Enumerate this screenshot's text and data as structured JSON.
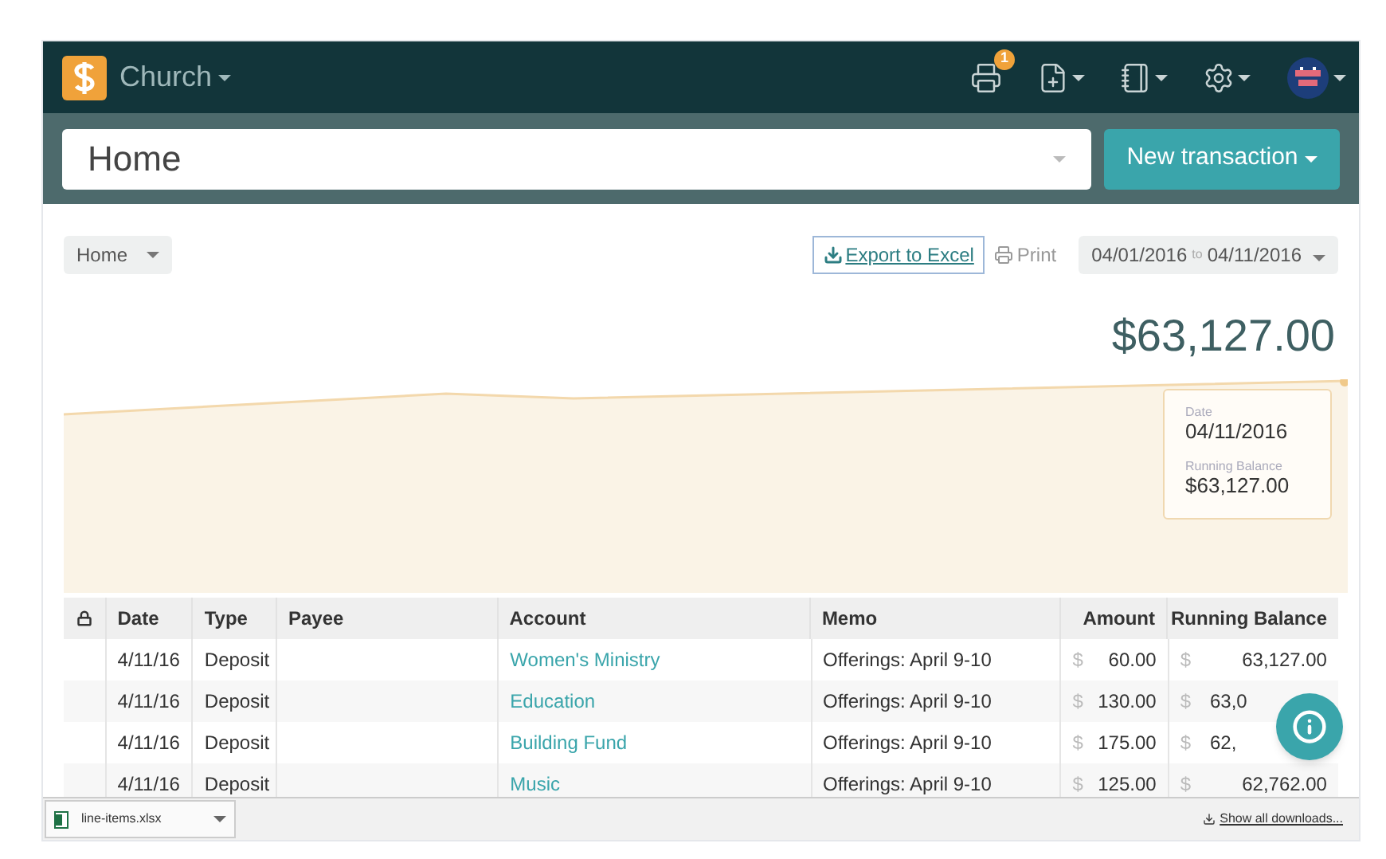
{
  "header": {
    "brand": "Church",
    "notification_count": "1"
  },
  "page_select": {
    "value": "Home"
  },
  "new_transaction": {
    "label": "New transaction"
  },
  "toolbar": {
    "view": "Home",
    "export": "Export to Excel",
    "print": "Print",
    "date_from": "04/01/2016",
    "date_sep": "to",
    "date_to": "04/11/2016"
  },
  "balance": "$63,127.00",
  "tooltip": {
    "date_label": "Date",
    "date": "04/11/2016",
    "balance_label": "Running Balance",
    "balance": "$63,127.00"
  },
  "table": {
    "columns": [
      "Date",
      "Type",
      "Payee",
      "Account",
      "Memo",
      "Amount",
      "Running Balance"
    ],
    "rows": [
      {
        "date": "4/11/16",
        "type": "Deposit",
        "account": "Women's Ministry",
        "memo": "Offerings: April 9-10",
        "currency": "$",
        "amount": "60.00",
        "balance_currency": "$",
        "balance": "63,127.00"
      },
      {
        "date": "4/11/16",
        "type": "Deposit",
        "account": "Education",
        "memo": "Offerings: April 9-10",
        "currency": "$",
        "amount": "130.00",
        "balance_currency": "$",
        "balance": "63,0"
      },
      {
        "date": "4/11/16",
        "type": "Deposit",
        "account": "Building Fund",
        "memo": "Offerings: April 9-10",
        "currency": "$",
        "amount": "175.00",
        "balance_currency": "$",
        "balance": "62,"
      },
      {
        "date": "4/11/16",
        "type": "Deposit",
        "account": "Music",
        "memo": "Offerings: April 9-10",
        "currency": "$",
        "amount": "125.00",
        "balance_currency": "$",
        "balance": "62,762.00"
      }
    ]
  },
  "downloads": {
    "file": "line-items.xlsx",
    "show_all": "Show all downloads..."
  }
}
